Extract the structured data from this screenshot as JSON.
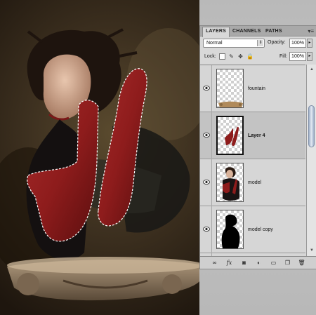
{
  "panel": {
    "tabs": [
      {
        "label": "LAYERS",
        "active": true
      },
      {
        "label": "CHANNELS",
        "active": false
      },
      {
        "label": "PATHS",
        "active": false
      }
    ],
    "menu_glyph": "▾≡",
    "blend_mode": "Normal",
    "opacity_label": "Opacity:",
    "opacity_value": "100%",
    "lock_label": "Lock:",
    "fill_label": "Fill:",
    "fill_value": "100%",
    "layers": [
      {
        "name": "fountain",
        "visible": true,
        "selected": false,
        "thumb": "fountain"
      },
      {
        "name": "Layer 4",
        "visible": true,
        "selected": true,
        "thumb": "gloves"
      },
      {
        "name": "model",
        "visible": true,
        "selected": false,
        "thumb": "model"
      },
      {
        "name": "model copy",
        "visible": true,
        "selected": false,
        "thumb": "silhouette"
      }
    ],
    "bottom_icons": [
      "link-icon",
      "fx-icon",
      "mask-icon",
      "adjustment-icon",
      "group-icon",
      "new-layer-icon",
      "trash-icon"
    ]
  },
  "colors": {
    "glove_red": "#8e1c1c",
    "panel_bg": "#d8d8d8",
    "selected_row": "#c3c3c3",
    "scroll_thumb": "#b8c6dc"
  }
}
